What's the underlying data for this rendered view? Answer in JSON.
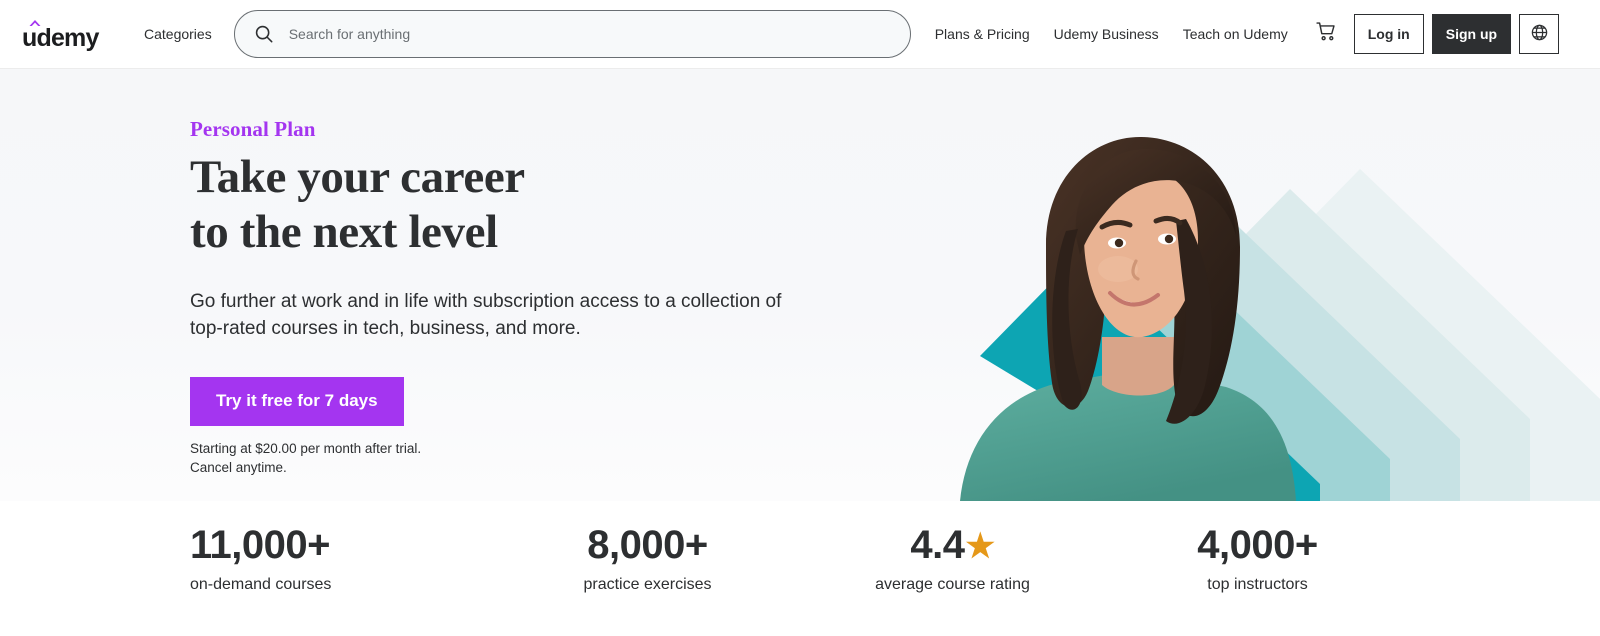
{
  "header": {
    "logo_text": "udemy",
    "logo_accent_color": "#A435F0",
    "categories_label": "Categories",
    "search": {
      "placeholder": "Search for anything",
      "value": "",
      "icon": "search-icon"
    },
    "nav_links": [
      {
        "label": "Plans & Pricing"
      },
      {
        "label": "Udemy Business"
      },
      {
        "label": "Teach on Udemy"
      }
    ],
    "cart_icon": "shopping-cart-icon",
    "login_label": "Log in",
    "signup_label": "Sign up",
    "language_icon": "globe-icon"
  },
  "hero": {
    "eyebrow": "Personal Plan",
    "headline_line1": "Take your career",
    "headline_line2": "to the next level",
    "subcopy": "Go further at work and in life with subscription access to a collection of top-rated courses in tech, business, and more.",
    "cta_label": "Try it free for 7 days",
    "finetext_line1": "Starting at $20.00 per month after trial.",
    "finetext_line2": "Cancel anytime.",
    "accent_color": "#A435F0",
    "art": {
      "alt": "Smiling woman in a teal sweater with layered teal chevron graphics",
      "chevron_colors": [
        "#0DA5B3",
        "#9FD3D5",
        "#C7E2E4",
        "#DCEBEC",
        "#EAF2F3"
      ],
      "sweater_color": "#53A596"
    }
  },
  "stats": [
    {
      "value": "11,000+",
      "label": "on-demand courses",
      "star": false
    },
    {
      "value": "8,000+",
      "label": "practice exercises",
      "star": false
    },
    {
      "value": "4.4",
      "label": "average course rating",
      "star": true,
      "star_glyph": "★",
      "star_color": "#e59819"
    },
    {
      "value": "4,000+",
      "label": "top instructors",
      "star": false
    }
  ]
}
